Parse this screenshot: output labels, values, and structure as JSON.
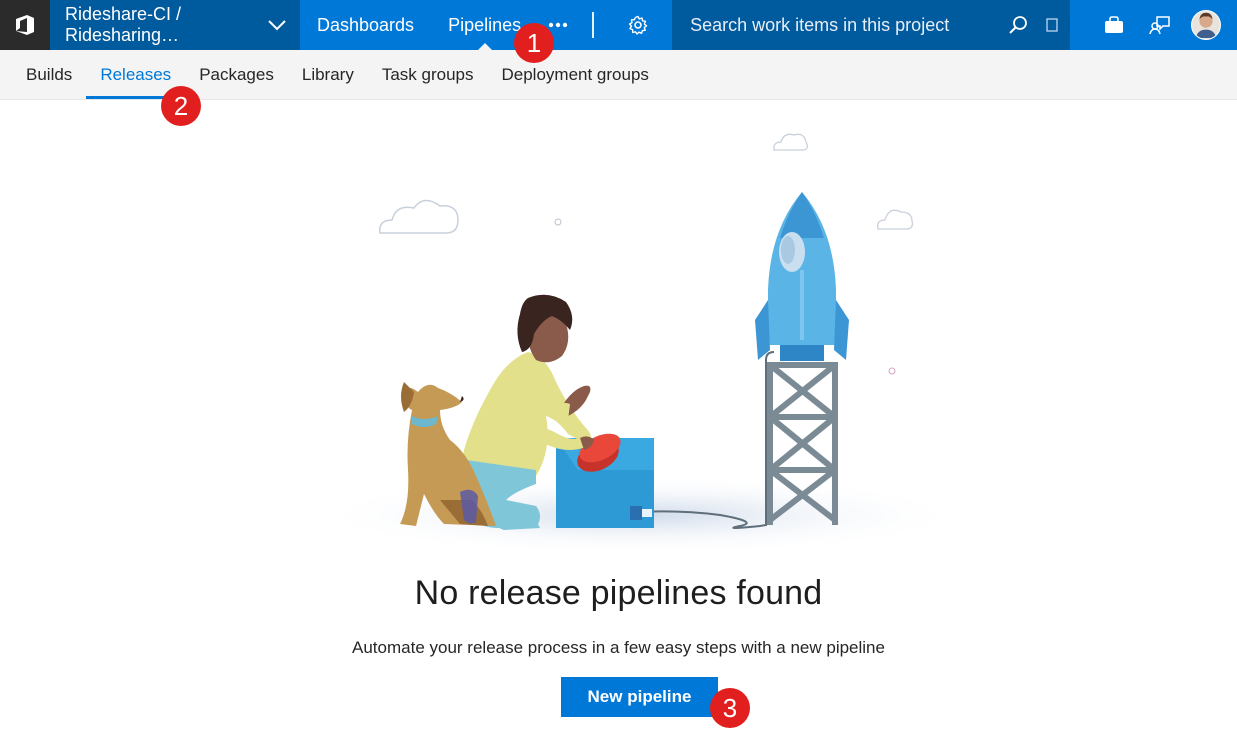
{
  "topbar": {
    "project_label": "Rideshare-CI / Ridesharing…",
    "hubs": [
      {
        "label": "Dashboards"
      },
      {
        "label": "Pipelines"
      }
    ],
    "search_placeholder": "Search work items in this project",
    "icons": [
      "vsts-logo-icon",
      "chevron-down-icon",
      "more-icon",
      "gear-icon",
      "search-icon",
      "expand-icon",
      "bag-icon",
      "feedback-icon",
      "avatar"
    ]
  },
  "subnav": {
    "tabs": [
      {
        "label": "Builds"
      },
      {
        "label": "Releases"
      },
      {
        "label": "Packages"
      },
      {
        "label": "Library"
      },
      {
        "label": "Task groups"
      },
      {
        "label": "Deployment groups"
      }
    ],
    "active_tab": "Releases"
  },
  "empty_state": {
    "title": "No release pipelines found",
    "description": "Automate your release process in a few easy steps with a new pipeline",
    "button_label": "New pipeline"
  },
  "callouts": [
    "1",
    "2",
    "3"
  ],
  "colors": {
    "brand_blue": "#0078d7",
    "dark_blue": "#005a9e",
    "callout_red": "#e21f1f"
  }
}
